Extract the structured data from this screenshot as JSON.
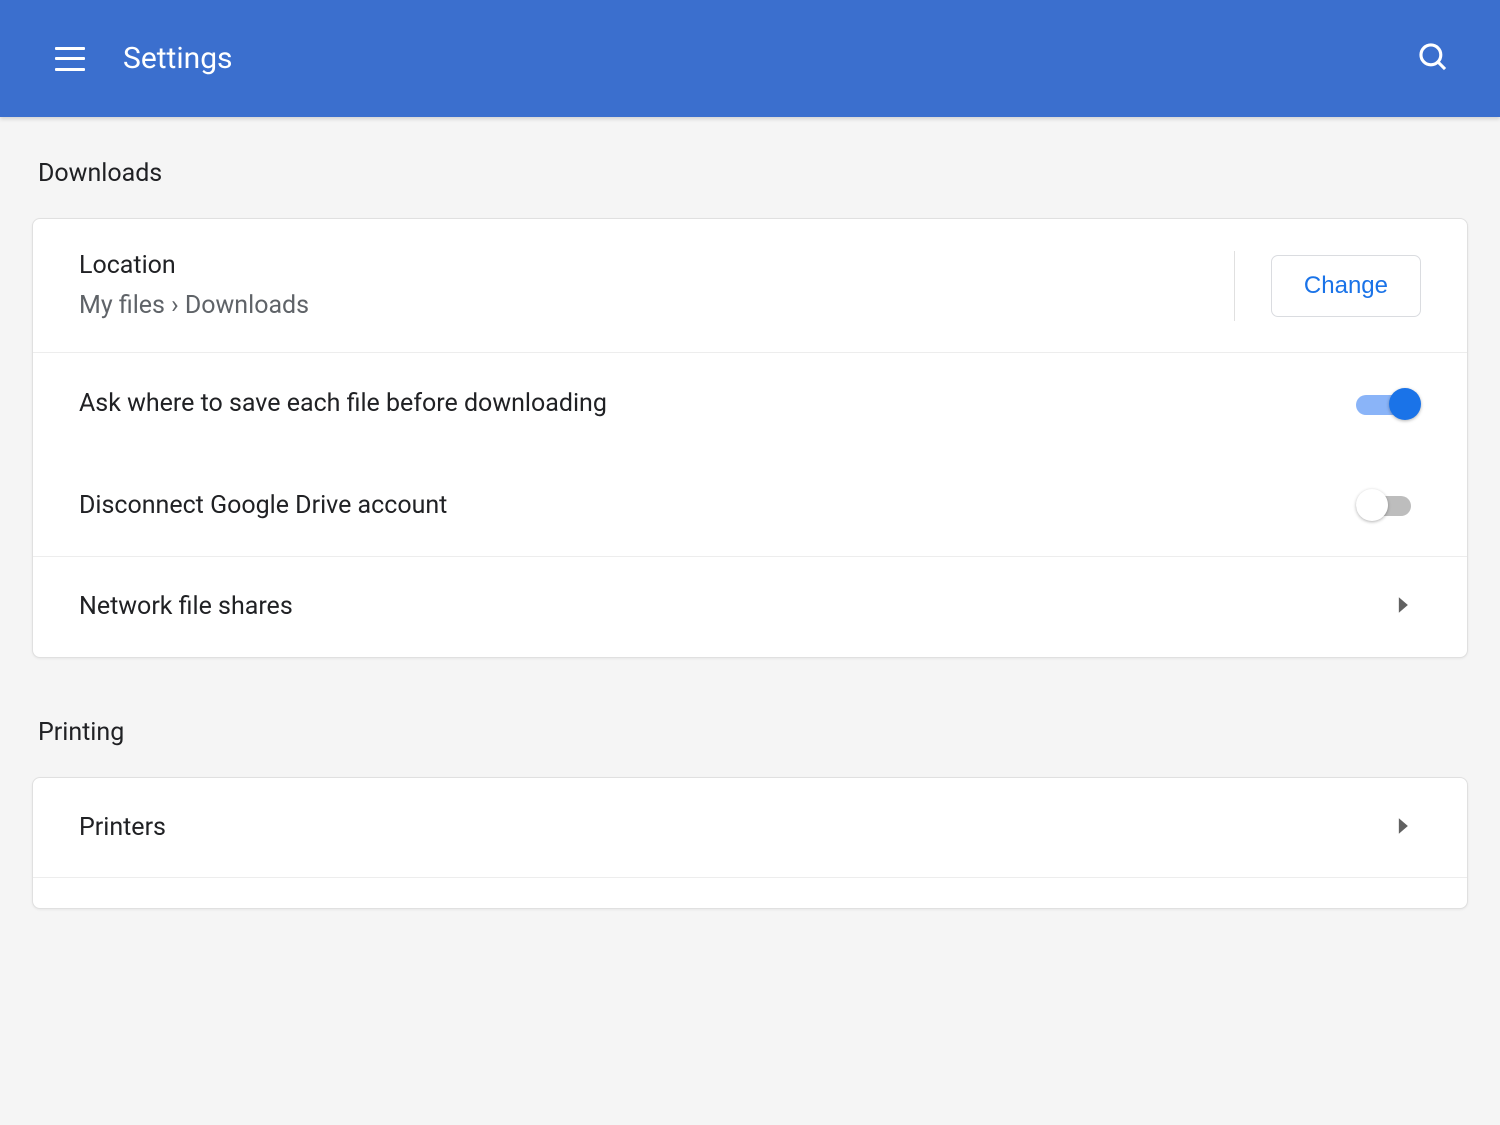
{
  "header": {
    "title": "Settings"
  },
  "sections": {
    "downloads": {
      "title": "Downloads",
      "location": {
        "label": "Location",
        "path": "My files › Downloads",
        "change_button": "Change"
      },
      "ask_save": {
        "label": "Ask where to save each file before downloading",
        "enabled": true
      },
      "disconnect_drive": {
        "label": "Disconnect Google Drive account",
        "enabled": false
      },
      "network_shares": {
        "label": "Network file shares"
      }
    },
    "printing": {
      "title": "Printing",
      "printers": {
        "label": "Printers"
      }
    }
  }
}
